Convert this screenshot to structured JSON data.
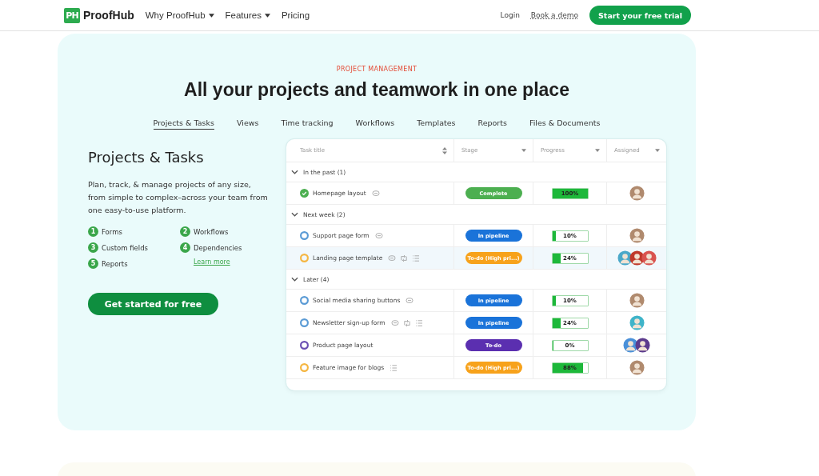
{
  "header": {
    "logo_mark": "PH",
    "logo_text": "ProofHub",
    "nav": [
      {
        "label": "Why ProofHub",
        "dropdown": true
      },
      {
        "label": "Features",
        "dropdown": true
      },
      {
        "label": "Pricing",
        "dropdown": false
      }
    ],
    "login": "Login",
    "demo": "Book a demo",
    "cta": "Start your free trial"
  },
  "hero": {
    "eyebrow": "PROJECT MANAGEMENT",
    "title": "All your projects and teamwork in one place",
    "tabs": [
      {
        "label": "Projects & Tasks",
        "selected": true
      },
      {
        "label": "Views",
        "selected": false
      },
      {
        "label": "Time tracking",
        "selected": false
      },
      {
        "label": "Workflows",
        "selected": false
      },
      {
        "label": "Templates",
        "selected": false
      },
      {
        "label": "Reports",
        "selected": false
      },
      {
        "label": "Files & Documents",
        "selected": false
      }
    ],
    "section_title": "Projects & Tasks",
    "description": "Plan, track, & manage projects of any size, from simple to complex–across your team from one easy-to-use platform.",
    "features": [
      {
        "number": "1",
        "label": "Forms"
      },
      {
        "number": "2",
        "label": "Workflows"
      },
      {
        "number": "3",
        "label": "Custom fields"
      },
      {
        "number": "4",
        "label": "Dependencies"
      },
      {
        "number": "5",
        "label": "Reports"
      }
    ],
    "learn_more": "Learn more",
    "button": "Get started for free"
  },
  "table": {
    "columns": [
      "Task title",
      "Stage",
      "Progress",
      "Assigned"
    ],
    "groups": [
      {
        "label": "In the past (1)",
        "expanded": true,
        "tasks": [
          {
            "title": "Homepage layout",
            "done": true,
            "color": "#4caf50",
            "comments": true,
            "recurring": false,
            "checklist": false,
            "stage": {
              "label": "Complete",
              "color": "#4caf50"
            },
            "progress": {
              "level": 1,
              "reading": "100%"
            },
            "assignees": [
              {
                "color": "#b08a6e"
              }
            ],
            "selected": false
          }
        ]
      },
      {
        "label": "Next week (2)",
        "expanded": true,
        "tasks": [
          {
            "title": "Support page form",
            "done": false,
            "color": "#5b9bd5",
            "comments": true,
            "recurring": false,
            "checklist": false,
            "stage": {
              "label": "In pipeline",
              "color": "#1a73d9"
            },
            "progress": {
              "level": 0.1,
              "reading": "10%"
            },
            "assignees": [
              {
                "color": "#b08a6e"
              }
            ],
            "selected": false
          },
          {
            "title": "Landing page template",
            "done": false,
            "color": "#f5b642",
            "comments": true,
            "recurring": true,
            "checklist": true,
            "stage": {
              "label": "To-do (High pri...)",
              "color": "#f7a21b"
            },
            "progress": {
              "level": 0.24,
              "reading": "24%"
            },
            "assignees": [
              {
                "color": "#4aa8c9"
              },
              {
                "color": "#c0392b"
              },
              {
                "color": "#d9534f"
              }
            ],
            "selected": true
          }
        ]
      },
      {
        "label": "Later (4)",
        "expanded": true,
        "tasks": [
          {
            "title": "Social media sharing buttons",
            "done": false,
            "color": "#5b9bd5",
            "comments": true,
            "recurring": false,
            "checklist": false,
            "stage": {
              "label": "In pipeline",
              "color": "#1a73d9"
            },
            "progress": {
              "level": 0.1,
              "reading": "10%"
            },
            "assignees": [
              {
                "color": "#b08a6e"
              }
            ],
            "selected": false
          },
          {
            "title": "Newsletter sign-up form",
            "done": false,
            "color": "#5b9bd5",
            "comments": true,
            "recurring": true,
            "checklist": true,
            "stage": {
              "label": "In pipeline",
              "color": "#1a73d9"
            },
            "progress": {
              "level": 0.24,
              "reading": "24%"
            },
            "assignees": [
              {
                "color": "#3fb4c9"
              }
            ],
            "selected": false
          },
          {
            "title": "Product page layout",
            "done": false,
            "color": "#6a4fb3",
            "comments": false,
            "recurring": false,
            "checklist": false,
            "stage": {
              "label": "To-do",
              "color": "#5b2fb0"
            },
            "progress": {
              "level": 0,
              "reading": "0%"
            },
            "assignees": [
              {
                "color": "#4a90d9"
              },
              {
                "color": "#5b3a8c"
              }
            ],
            "selected": false
          },
          {
            "title": "Feature image for blogs",
            "done": false,
            "color": "#f5b642",
            "comments": false,
            "recurring": false,
            "checklist": true,
            "stage": {
              "label": "To-do (High pri...)",
              "color": "#f7a21b"
            },
            "progress": {
              "level": 0.88,
              "reading": "88%"
            },
            "assignees": [
              {
                "color": "#b08a6e"
              }
            ],
            "selected": false
          }
        ]
      }
    ]
  }
}
